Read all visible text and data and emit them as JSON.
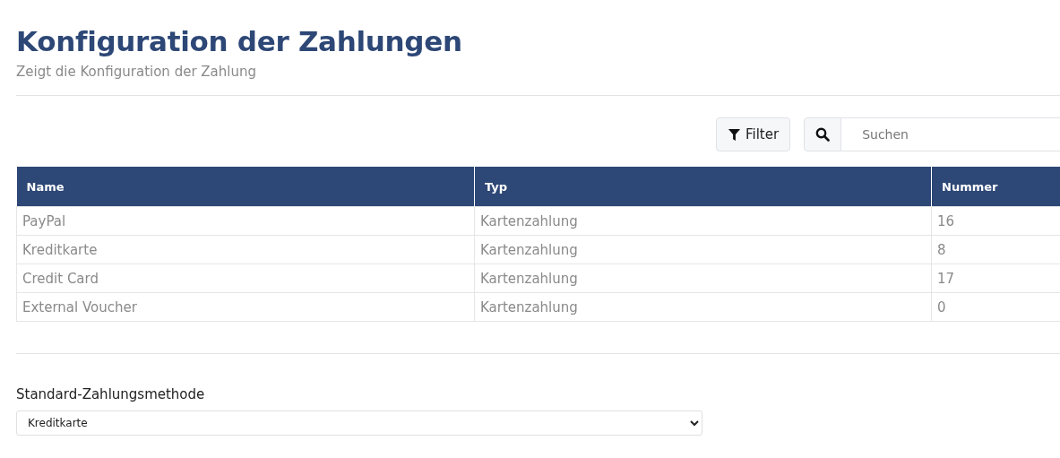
{
  "header": {
    "title": "Konfiguration der Zahlungen",
    "subtitle": "Zeigt die Konfiguration der Zahlung"
  },
  "toolbar": {
    "filter_button": "Filter",
    "search": {
      "placeholder": "Suchen"
    }
  },
  "table": {
    "columns": [
      "Name",
      "Typ",
      "Nummer"
    ],
    "rows": [
      [
        "PayPal",
        "Kartenzahlung",
        "16"
      ],
      [
        "Kreditkarte",
        "Kartenzahlung",
        "8"
      ],
      [
        "Credit Card",
        "Kartenzahlung",
        "17"
      ],
      [
        "External Voucher",
        "Kartenzahlung",
        "0"
      ]
    ]
  },
  "default_method": {
    "label": "Standard-Zahlungsmethode",
    "value": "Kreditkarte"
  }
}
